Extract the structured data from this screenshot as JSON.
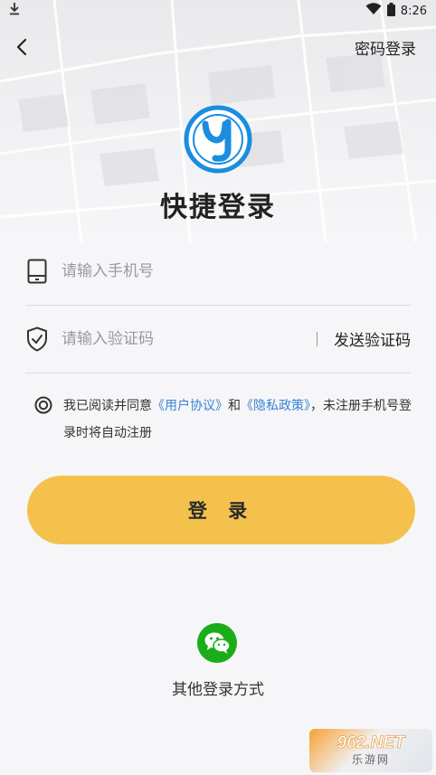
{
  "status_bar": {
    "time": "8:26",
    "left_icon": "download-icon",
    "right_icons": [
      "wifi-icon",
      "battery-icon"
    ]
  },
  "header": {
    "back_icon": "back-arrow-icon",
    "password_login_label": "密码登录"
  },
  "logo": {
    "icon": "app-logo-icon",
    "colors": {
      "ring": "#1a8de0",
      "letter": "#1a8de0"
    }
  },
  "title": "快捷登录",
  "phone_field": {
    "icon": "phone-icon",
    "value": "",
    "placeholder": "请输入手机号"
  },
  "code_field": {
    "icon": "shield-icon",
    "value": "",
    "placeholder": "请输入验证码",
    "send_code_label": "发送验证码"
  },
  "agreement": {
    "checked": false,
    "prefix": "我已阅读并同意",
    "user_agreement": "《用户协议》",
    "and": "和",
    "privacy_policy": "《隐私政策》",
    "suffix": "，未注册手机号登录时将自动注册"
  },
  "login_button_label": "登 录",
  "other_login": {
    "wechat_icon": "wechat-icon",
    "label": "其他登录方式"
  },
  "watermark": {
    "top": "962.NET",
    "bottom": "乐游网"
  },
  "colors": {
    "accent": "#f4c14c",
    "link": "#3a82d6",
    "wechat": "#1aad19",
    "background": "#f6f6f8"
  }
}
